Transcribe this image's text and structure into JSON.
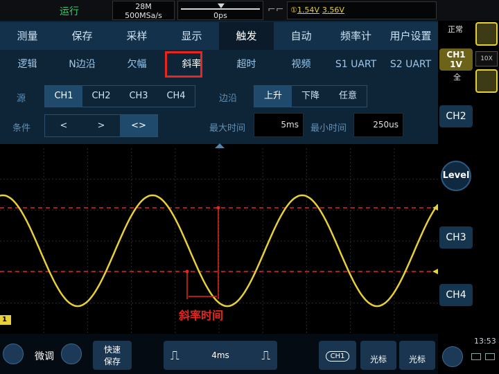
{
  "top": {
    "run_status": "运行",
    "memory": "28M",
    "sample_rate": "500MSa/s",
    "time_offset": "0ps",
    "trigger_level_1": "1.54V",
    "trigger_level_2": "3.56V"
  },
  "tabs": [
    "测量",
    "保存",
    "采样",
    "显示",
    "触发",
    "自动",
    "频率计",
    "用户设置"
  ],
  "active_tab": "触发",
  "subtabs": [
    "逻辑",
    "N边沿",
    "欠幅",
    "斜率",
    "超时",
    "视频",
    "S1 UART",
    "S2 UART"
  ],
  "active_subtab": "斜率",
  "settings": {
    "source_label": "源",
    "source_options": [
      "CH1",
      "CH2",
      "CH3",
      "CH4"
    ],
    "source_selected": "CH1",
    "edge_label": "边沿",
    "edge_options": [
      "上升",
      "下降",
      "任意"
    ],
    "edge_selected": "上升",
    "condition_label": "条件",
    "condition_options": [
      "<",
      ">",
      "<>"
    ],
    "condition_selected": "<>",
    "max_time_label": "最大时间",
    "max_time_value": "5ms",
    "min_time_label": "最小时间",
    "min_time_value": "250us"
  },
  "waveform": {
    "annotation": "斜率时间",
    "ch1_marker": "1",
    "trace_color": "#e8d038",
    "annotation_color": "#e8251e"
  },
  "right": {
    "mode": "正常",
    "ch1_label": "CH1",
    "ch1_scale": "1V",
    "full_label": "全",
    "probe": "10X",
    "ch2": "CH2",
    "level": "Level",
    "ch3": "CH3",
    "ch4": "CH4",
    "clock": "13:53"
  },
  "bottom": {
    "fine_tune": "微调",
    "quick_save_1": "快速",
    "quick_save_2": "保存",
    "timebase": "4ms",
    "ch1_badge": "CH1",
    "cursor_1": "光标",
    "cursor_2": "光标"
  }
}
